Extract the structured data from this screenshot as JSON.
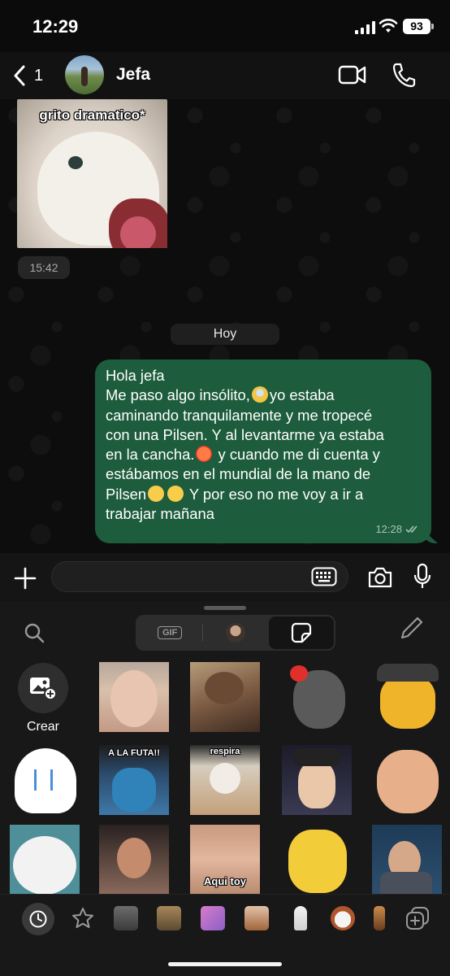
{
  "status_bar": {
    "time": "12:29",
    "battery": "93"
  },
  "header": {
    "back_count": "1",
    "contact_name": "Jefa"
  },
  "chat": {
    "sticker_caption": "grito dramatico*",
    "sticker_time": "15:42",
    "date_separator": "Hoy",
    "outgoing_message": {
      "lines": [
        "Hola jefa",
        "Me paso algo insólito,",
        "yo estaba",
        "caminando tranquilamente y me tropecé",
        "con una Pilsen.  Y al levantarme ya estaba",
        "en la cancha.",
        " y cuando me di cuenta y",
        "estábamos en el mundial de la mano de",
        "Pilsen",
        " Y por eso no me voy a ir a",
        "trabajar mañana"
      ],
      "time": "12:28"
    }
  },
  "input_bar": {
    "placeholder": ""
  },
  "sticker_panel": {
    "segments": [
      {
        "label": "GIF"
      }
    ],
    "create_label": "Crear",
    "tile_captions": {
      "a_la_futa": "A LA FUTA!!",
      "respira": "respira",
      "aqui_toy": "Aqui toy"
    }
  },
  "icons": [
    "back-icon",
    "video-icon",
    "phone-icon",
    "plus-icon",
    "keyboard-icon",
    "camera-icon",
    "mic-icon",
    "search-icon",
    "gif-icon",
    "sticker-icon",
    "pencil-icon",
    "add-photo-icon",
    "clock-icon",
    "star-icon",
    "add-pack-icon"
  ],
  "colors": {
    "outgoing_bubble": "#1d5c3c",
    "background": "#0b0b0b",
    "panel": "#181818"
  }
}
